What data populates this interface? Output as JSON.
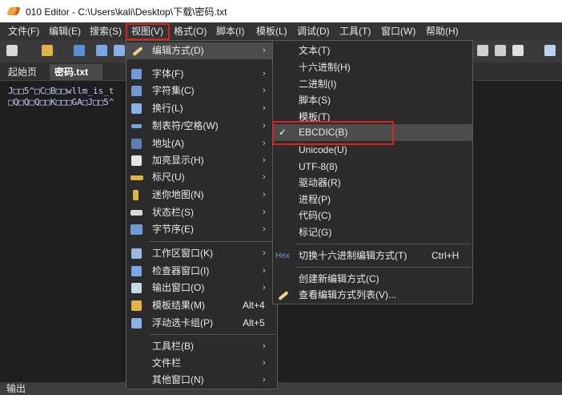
{
  "title": {
    "text": "010 Editor - C:\\Users\\kali\\Desktop\\下载\\密码.txt"
  },
  "menubar": {
    "items": [
      "文件(F)",
      "编辑(E)",
      "搜索(S)",
      "视图(V)",
      "格式(O)",
      "脚本(I)",
      "模板(L)",
      "调试(D)",
      "工具(T)",
      "窗口(W)",
      "帮助(H)"
    ]
  },
  "tabs": {
    "start": "起始页",
    "active": "密码.txt"
  },
  "tab_close_glyph": "×",
  "editor": {
    "line1": "J□□5^□C□B□□wllm_is_t",
    "line2": "□Q□Q□Q□□K□□□GA□J□□5^"
  },
  "statusbar": {
    "label": "输出"
  },
  "view_menu": {
    "items": [
      {
        "label": "编辑方式(D)",
        "shortcut": "",
        "submenu": true,
        "icon": "pencil-icon"
      },
      {
        "label": "字体(F)",
        "shortcut": "",
        "submenu": true,
        "icon": "font-icon"
      },
      {
        "label": "字符集(C)",
        "shortcut": "",
        "submenu": true,
        "icon": "charset-icon"
      },
      {
        "label": "换行(L)",
        "shortcut": "",
        "submenu": true,
        "icon": "wrap-icon"
      },
      {
        "label": "制表符/空格(W)",
        "shortcut": "",
        "submenu": true,
        "icon": "tab-space-icon"
      },
      {
        "label": "地址(A)",
        "shortcut": "",
        "submenu": true,
        "icon": "address-icon"
      },
      {
        "label": "加亮显示(H)",
        "shortcut": "",
        "submenu": true,
        "icon": "highlight-icon"
      },
      {
        "label": "标尺(U)",
        "shortcut": "",
        "submenu": true,
        "icon": "ruler-icon"
      },
      {
        "label": "迷你地图(N)",
        "shortcut": "",
        "submenu": true,
        "icon": "minimap-icon"
      },
      {
        "label": "状态栏(S)",
        "shortcut": "",
        "submenu": true,
        "icon": "statusbar-icon"
      },
      {
        "label": "字节序(E)",
        "shortcut": "",
        "submenu": true,
        "icon": "byte-order-icon"
      },
      {
        "label": "工作区窗口(K)",
        "shortcut": "",
        "submenu": true,
        "icon": "workspace-icon"
      },
      {
        "label": "检查器窗口(I)",
        "shortcut": "",
        "submenu": true,
        "icon": "inspector-icon"
      },
      {
        "label": "输出窗口(O)",
        "shortcut": "",
        "submenu": true,
        "icon": "output-icon"
      },
      {
        "label": "模板结果(M)",
        "shortcut": "Alt+4",
        "submenu": false,
        "icon": "template-results-icon"
      },
      {
        "label": "浮动选卡组(P)",
        "shortcut": "Alt+5",
        "submenu": false,
        "icon": "floating-tabs-icon"
      },
      {
        "label": "工具栏(B)",
        "shortcut": "",
        "submenu": true,
        "icon": ""
      },
      {
        "label": "文件栏",
        "shortcut": "",
        "submenu": true,
        "icon": ""
      },
      {
        "label": "其他窗口(N)",
        "shortcut": "",
        "submenu": true,
        "icon": ""
      }
    ]
  },
  "edit_as_menu": {
    "items": [
      {
        "label": "文本(T)",
        "checked": false,
        "prefix": "",
        "shortcut": ""
      },
      {
        "label": "十六进制(H)",
        "checked": false,
        "prefix": "",
        "shortcut": ""
      },
      {
        "label": "二进制(I)",
        "checked": false,
        "prefix": "",
        "shortcut": ""
      },
      {
        "label": "脚本(S)",
        "checked": false,
        "prefix": "",
        "shortcut": ""
      },
      {
        "label": "模板(T)",
        "checked": false,
        "prefix": "",
        "shortcut": ""
      },
      {
        "label": "EBCDIC(B)",
        "checked": true,
        "prefix": "",
        "shortcut": ""
      },
      {
        "label": "Unicode(U)",
        "checked": false,
        "prefix": "",
        "shortcut": ""
      },
      {
        "label": "UTF-8(8)",
        "checked": false,
        "prefix": "",
        "shortcut": ""
      },
      {
        "label": "驱动器(R)",
        "checked": false,
        "prefix": "",
        "shortcut": ""
      },
      {
        "label": "进程(P)",
        "checked": false,
        "prefix": "",
        "shortcut": ""
      },
      {
        "label": "代码(C)",
        "checked": false,
        "prefix": "",
        "shortcut": ""
      },
      {
        "label": "标记(G)",
        "checked": false,
        "prefix": "",
        "shortcut": ""
      },
      {
        "label": "切换十六进制编辑方式(T)",
        "checked": false,
        "prefix": "Hex",
        "shortcut": "Ctrl+H"
      },
      {
        "label": "创建新编辑方式(C)",
        "checked": false,
        "prefix": "",
        "shortcut": ""
      },
      {
        "label": "查看编辑方式列表(V)...",
        "checked": false,
        "prefix": "",
        "shortcut": ""
      }
    ]
  },
  "glyphs": {
    "arrow": "›",
    "check": "✓"
  },
  "colors": {
    "highlight_box": "#e0221e",
    "menu_bg": "#2b2b2b",
    "selected_bg": "#4c4c4c"
  }
}
